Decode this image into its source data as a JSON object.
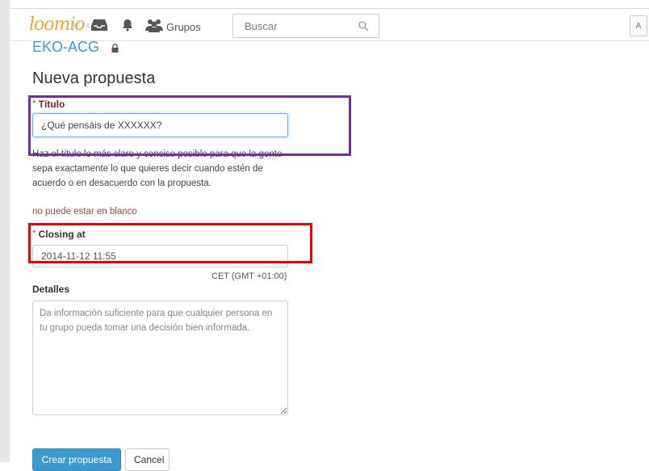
{
  "header": {
    "logo_text": "loomio",
    "beta_label": "BETA",
    "groups_label": "Grupos",
    "search": {
      "placeholder": "Buscar",
      "value": ""
    },
    "avatar_initial": "A",
    "icons": [
      "inbox-icon",
      "bell-icon",
      "groups-icon",
      "search-icon"
    ]
  },
  "group": {
    "name": "EKO-ACG",
    "lock_icon": "lock-icon"
  },
  "form": {
    "title": "Nueva propuesta",
    "required_mark": "*",
    "title_field": {
      "label": "Título",
      "value": "¿Qué pensáis de XXXXXX?",
      "help": "Haz el título lo más claro y conciso posible para que la gente sepa exactamente lo que quieres decir cuando estén de acuerdo o en desacuerdo con la propuesta."
    },
    "error": "no puede estar en blanco",
    "closing_field": {
      "label": "Closing at",
      "value": "2014-11-12 11:55",
      "timezone": "CET (GMT +01:00)"
    },
    "details_field": {
      "label": "Detalles",
      "placeholder": "Da información suficiente para que cualquier persona en tu grupo pueda tomar una decisión bien informada."
    },
    "submit_label": "Crear propuesta",
    "cancel_label": "Cancel"
  },
  "colors": {
    "brand": "#f2a32a",
    "link": "#3d9ad1",
    "error": "#a94442",
    "highlight_purple": "#7030a0",
    "highlight_red": "#ee0000"
  }
}
